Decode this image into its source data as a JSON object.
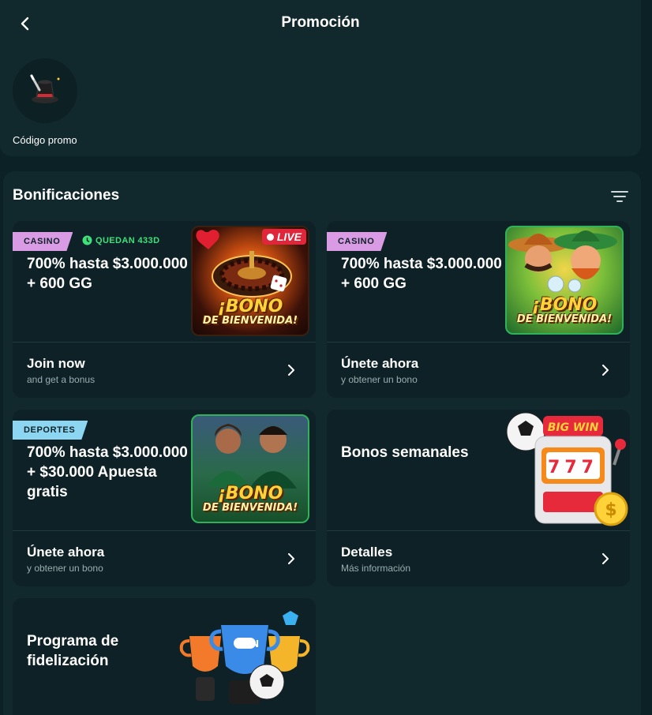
{
  "header": {
    "title": "Promoción"
  },
  "promo": {
    "label": "Código promo",
    "icon": "magic-hat-icon"
  },
  "section": {
    "title": "Bonificaciones"
  },
  "cards": [
    {
      "tag": "CASINO",
      "timer": "QUEDAN 433D",
      "title_line1": "700% hasta $3.000.000",
      "title_line2": "+ 600 GG",
      "art_badge": "LIVE",
      "art_bono": "¡BONO",
      "art_bienvenida": "DE BIENVENIDA!",
      "cta_title": "Join now",
      "cta_sub": "and get a bonus"
    },
    {
      "tag": "CASINO",
      "title_line1": "700% hasta $3.000.000",
      "title_line2": "+ 600 GG",
      "art_bono": "¡BONO",
      "art_bienvenida": "DE BIENVENIDA!",
      "cta_title": "Únete ahora",
      "cta_sub": "y obtener un bono"
    },
    {
      "tag": "DEPORTES",
      "title_line1": "700% hasta $3.000.000",
      "title_line2": "+ $30.000 Apuesta",
      "title_line3": "gratis",
      "art_bono": "¡BONO",
      "art_bienvenida": "DE BIENVENIDA!",
      "cta_title": "Únete ahora",
      "cta_sub": "y obtener un bono"
    },
    {
      "title": "Bonos semanales",
      "art_sign": "BIG WIN",
      "art_reels": "777",
      "cta_title": "Detalles",
      "cta_sub": "Más información"
    },
    {
      "title_line1": "Programa de",
      "title_line2": "fidelización",
      "art_logo": "ON"
    }
  ],
  "colors": {
    "background": "#0c2126",
    "panel": "#11282d",
    "card": "#0d2126",
    "casino_tag": "#d99be3",
    "deportes_tag": "#8cd6f2",
    "timer": "#3ee07a",
    "live_badge": "#e0263a"
  }
}
